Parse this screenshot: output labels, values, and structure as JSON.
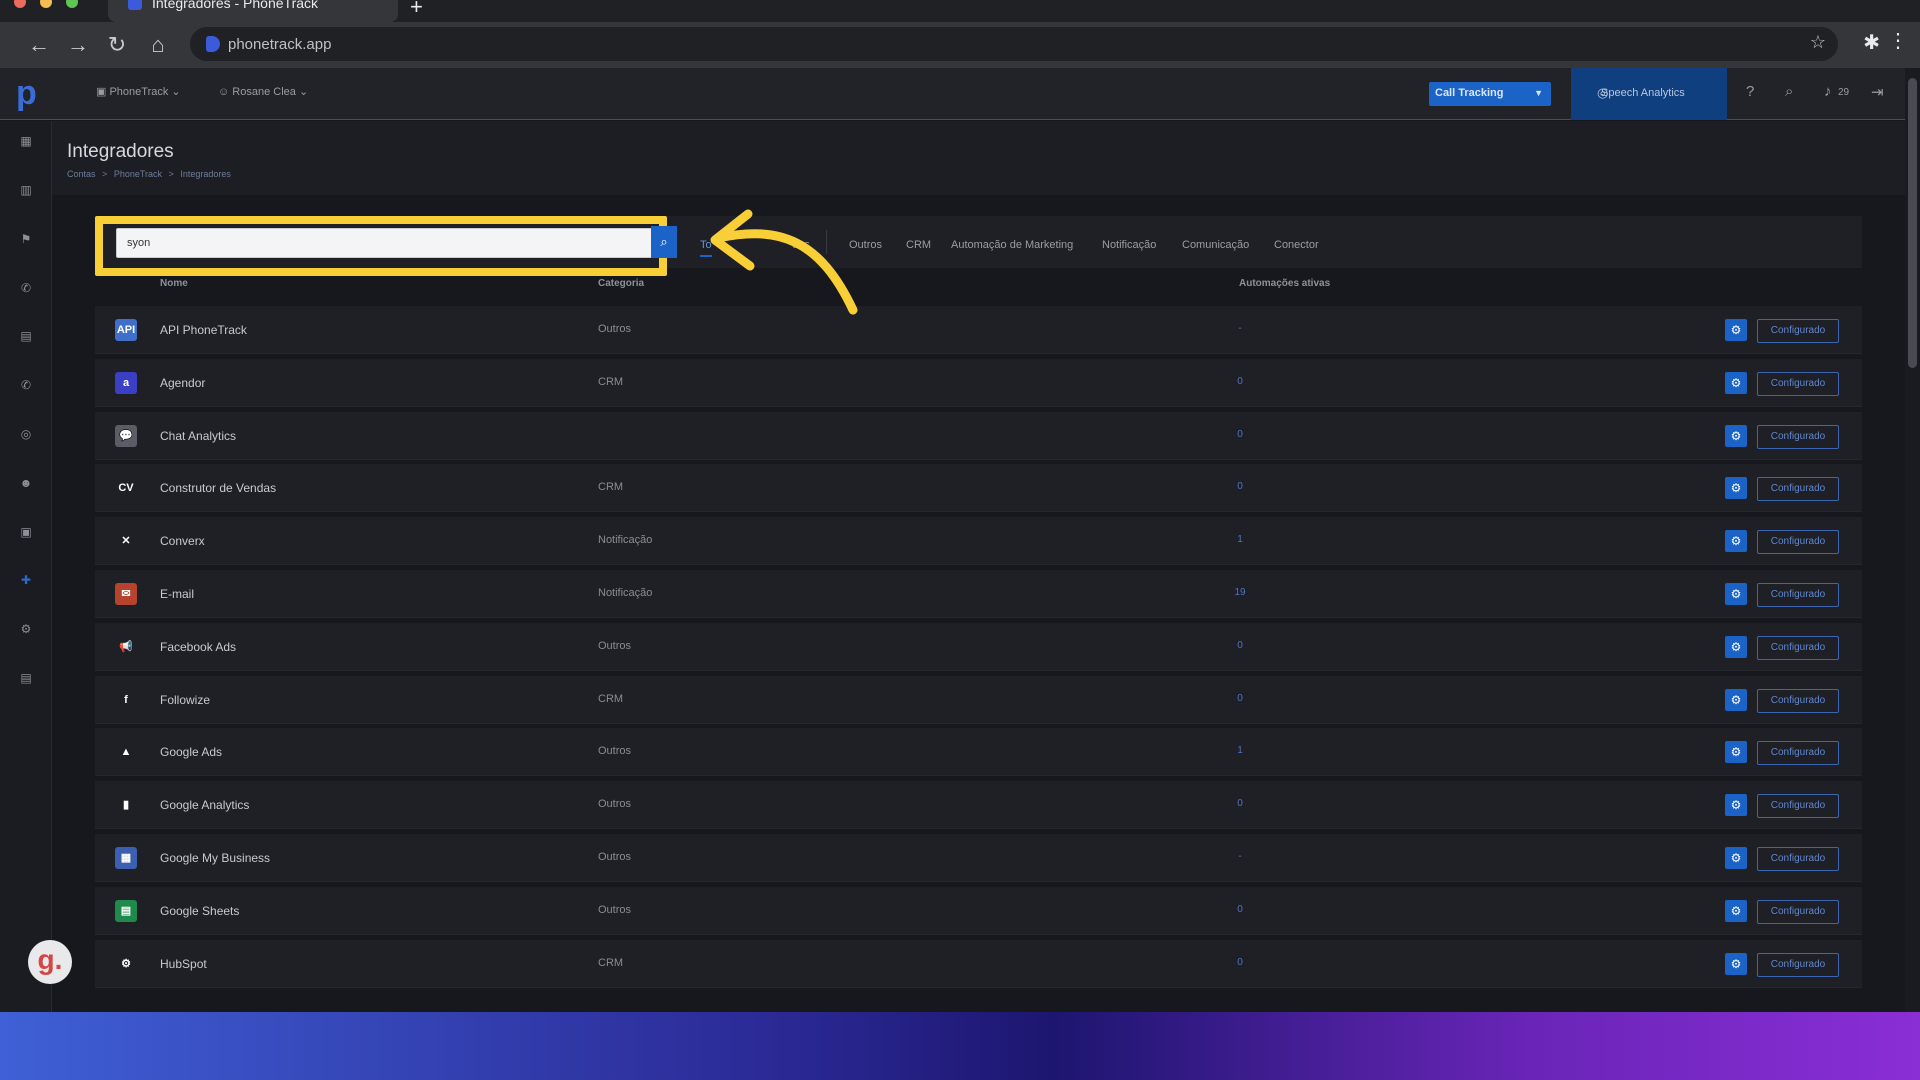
{
  "browser": {
    "tab_title": "Integradores - PhoneTrack",
    "url": "phonetrack.app"
  },
  "header": {
    "org": "PhoneTrack",
    "user": "Rosane Clea",
    "product_select": "Call Tracking",
    "speech_analytics": "Speech Analytics",
    "notifications_count": "29"
  },
  "page": {
    "title": "Integradores",
    "breadcrumb": [
      "Contas",
      ">",
      "PhoneTrack",
      ">",
      "Integradores"
    ]
  },
  "filter": {
    "search_value": "syon",
    "tabs": [
      "To",
      "ões",
      "Outros",
      "CRM",
      "Automação de Marketing",
      "Notificação",
      "Comunicação",
      "Conector"
    ]
  },
  "table": {
    "headers": [
      "Nome",
      "Categoria",
      "Automações ativas"
    ],
    "rows": [
      {
        "name": "API PhoneTrack",
        "category": "Outros",
        "auto": "-",
        "icon": "api-icon",
        "color": "#3f6fc8",
        "glyph": "API"
      },
      {
        "name": "Agendor",
        "category": "CRM",
        "auto": "0",
        "icon": "agendor-icon",
        "color": "#3a3fc4",
        "glyph": "a"
      },
      {
        "name": "Chat Analytics",
        "category": "",
        "auto": "0",
        "icon": "chat-icon",
        "color": "#5a5d66",
        "glyph": "💬"
      },
      {
        "name": "Construtor de Vendas",
        "category": "CRM",
        "auto": "0",
        "icon": "cv-icon",
        "color": "#1f2026",
        "glyph": "CV"
      },
      {
        "name": "Converx",
        "category": "Notificação",
        "auto": "1",
        "icon": "converx-icon",
        "color": "#1f2026",
        "glyph": "✕"
      },
      {
        "name": "E-mail",
        "category": "Notificação",
        "auto": "19",
        "icon": "email-icon",
        "color": "#b6432e",
        "glyph": "✉"
      },
      {
        "name": "Facebook Ads",
        "category": "Outros",
        "auto": "0",
        "icon": "megaphone-icon",
        "color": "#1f2026",
        "glyph": "📢"
      },
      {
        "name": "Followize",
        "category": "CRM",
        "auto": "0",
        "icon": "followize-icon",
        "color": "#1f2026",
        "glyph": "f"
      },
      {
        "name": "Google Ads",
        "category": "Outros",
        "auto": "1",
        "icon": "google-ads-icon",
        "color": "#1f2026",
        "glyph": "▲"
      },
      {
        "name": "Google Analytics",
        "category": "Outros",
        "auto": "0",
        "icon": "google-analytics-icon",
        "color": "#1f2026",
        "glyph": "▮"
      },
      {
        "name": "Google My Business",
        "category": "Outros",
        "auto": "-",
        "icon": "gmb-icon",
        "color": "#3c5fb0",
        "glyph": "▦"
      },
      {
        "name": "Google Sheets",
        "category": "Outros",
        "auto": "0",
        "icon": "sheets-icon",
        "color": "#1f8a4c",
        "glyph": "▤"
      },
      {
        "name": "HubSpot",
        "category": "CRM",
        "auto": "0",
        "icon": "hubspot-icon",
        "color": "#1f2026",
        "glyph": "⚙"
      }
    ],
    "config_label": "Configurado"
  }
}
